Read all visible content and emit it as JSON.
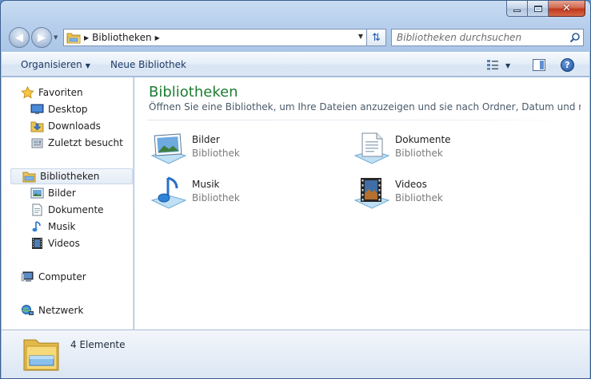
{
  "window": {
    "minimize_glyph": "",
    "close_glyph": "✕"
  },
  "address": {
    "path": "Bibliotheken",
    "refresh_glyph": "⇅"
  },
  "search": {
    "placeholder": "Bibliotheken durchsuchen"
  },
  "toolbar": {
    "organize_label": "Organisieren",
    "new_library_label": "Neue Bibliothek",
    "help_label": "?"
  },
  "sidebar": {
    "favorites": {
      "label": "Favoriten",
      "items": [
        {
          "label": "Desktop",
          "icon": "desktop-icon"
        },
        {
          "label": "Downloads",
          "icon": "downloads-icon"
        },
        {
          "label": "Zuletzt besucht",
          "icon": "recent-places-icon"
        }
      ]
    },
    "libraries": {
      "label": "Bibliotheken",
      "items": [
        {
          "label": "Bilder",
          "icon": "pictures-icon"
        },
        {
          "label": "Dokumente",
          "icon": "documents-icon"
        },
        {
          "label": "Musik",
          "icon": "music-icon"
        },
        {
          "label": "Videos",
          "icon": "videos-icon"
        }
      ]
    },
    "computer": {
      "label": "Computer"
    },
    "network": {
      "label": "Netzwerk"
    }
  },
  "main": {
    "title": "Bibliotheken",
    "subtitle": "Öffnen Sie eine Bibliothek, um Ihre Dateien anzuzeigen und sie nach Ordner, Datum und nach w...",
    "libraries": [
      {
        "name": "Bilder",
        "type": "Bibliothek",
        "icon": "pictures-library-icon"
      },
      {
        "name": "Dokumente",
        "type": "Bibliothek",
        "icon": "documents-library-icon"
      },
      {
        "name": "Musik",
        "type": "Bibliothek",
        "icon": "music-library-icon"
      },
      {
        "name": "Videos",
        "type": "Bibliothek",
        "icon": "videos-library-icon"
      }
    ]
  },
  "status": {
    "count_text": "4 Elemente"
  },
  "colors": {
    "title_green": "#1e7d32",
    "accent_blue": "#1e5aa8"
  }
}
